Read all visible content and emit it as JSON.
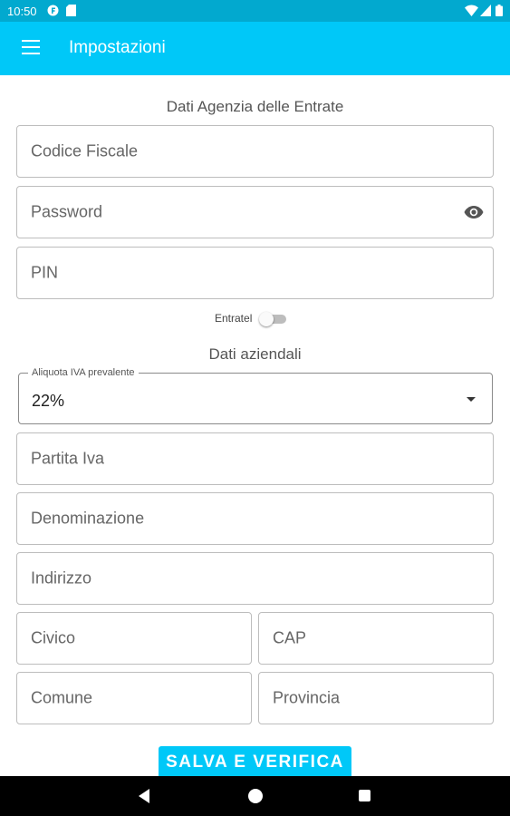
{
  "status_bar": {
    "time": "10:50",
    "icons": [
      "notification-f-icon",
      "sd-card-icon",
      "wifi-icon",
      "signal-icon",
      "battery-icon"
    ]
  },
  "app_bar": {
    "title": "Impostazioni",
    "menu_icon": "menu-icon"
  },
  "section_agenzia": {
    "title": "Dati Agenzia delle Entrate",
    "codice_fiscale_placeholder": "Codice Fiscale",
    "password_placeholder": "Password",
    "pin_placeholder": "PIN"
  },
  "entratel_toggle": {
    "label": "Entratel",
    "checked": false
  },
  "section_aziendali": {
    "title": "Dati aziendali",
    "aliquota_label": "Aliquota IVA prevalente",
    "aliquota_value": "22%",
    "partita_iva_placeholder": "Partita Iva",
    "denominazione_placeholder": "Denominazione",
    "indirizzo_placeholder": "Indirizzo",
    "civico_placeholder": "Civico",
    "cap_placeholder": "CAP",
    "comune_placeholder": "Comune",
    "provincia_placeholder": "Provincia"
  },
  "save_button": {
    "label": "SALVA E VERIFICA"
  },
  "colors": {
    "accent": "#00c8f8",
    "status_bar": "#02a9cf"
  }
}
